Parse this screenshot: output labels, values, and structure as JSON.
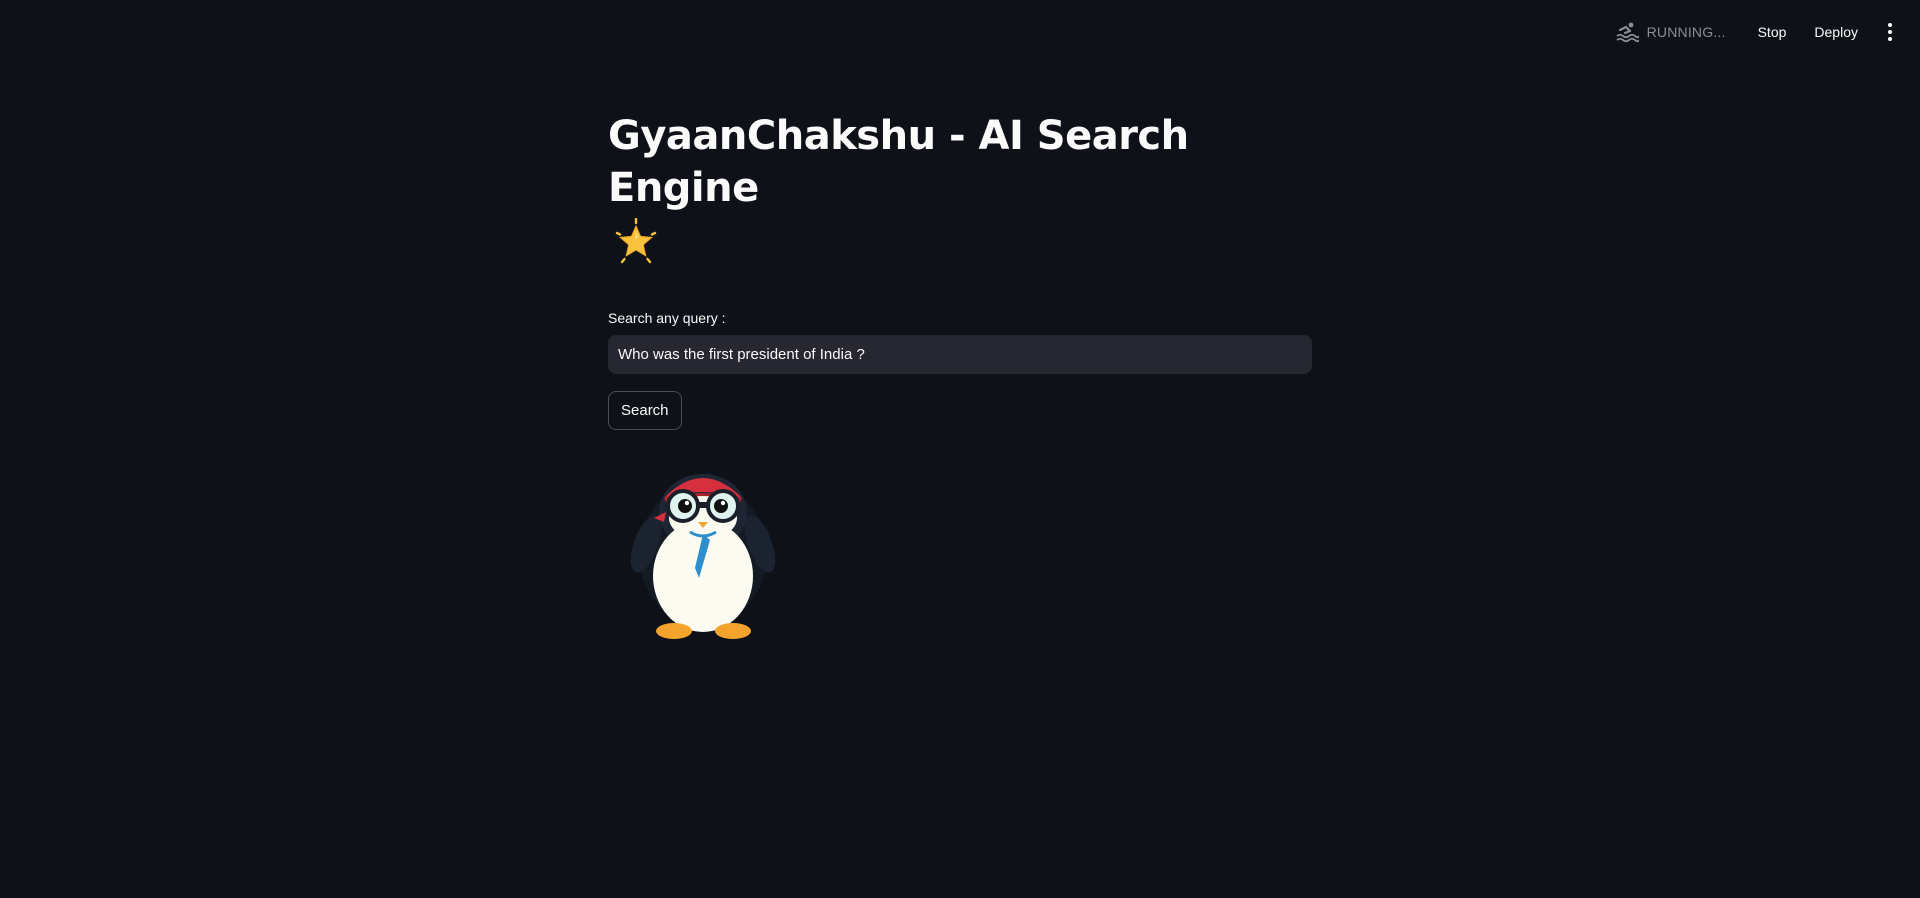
{
  "toolbar": {
    "status_icon": "swimmer-icon",
    "status_text": "RUNNING...",
    "stop_label": "Stop",
    "deploy_label": "Deploy",
    "menu_icon": "kebab-menu-icon"
  },
  "main": {
    "title": "GyaanChakshu - AI Search Engine",
    "title_emoji": "glowing-star-icon",
    "search_label": "Search any query :",
    "search_value": "Who was the first president of India ?",
    "search_button_label": "Search",
    "image": "penguin-with-binoculars"
  },
  "colors": {
    "background": "#0e1117",
    "input_background": "#262730",
    "text": "#fafafa",
    "muted_text": "#8a8d96",
    "star": "#f9c23c"
  }
}
